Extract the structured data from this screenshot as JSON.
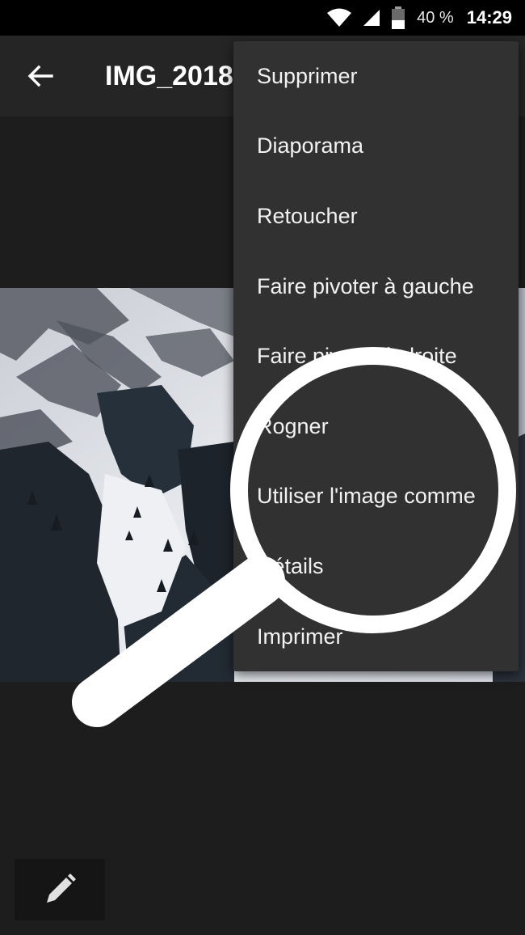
{
  "status_bar": {
    "battery_percent": "40 %",
    "time": "14:29",
    "icons": [
      "wifi-icon",
      "cell-signal-icon",
      "battery-icon"
    ]
  },
  "toolbar": {
    "title": "IMG_2018",
    "back_icon": "arrow-left-icon"
  },
  "menu": {
    "items": [
      {
        "label": "Supprimer"
      },
      {
        "label": "Diaporama"
      },
      {
        "label": "Retoucher"
      },
      {
        "label": "Faire pivoter à gauche"
      },
      {
        "label": "Faire pivoter à droite"
      },
      {
        "label": "Rogner"
      },
      {
        "label": "Utiliser l'image comme"
      },
      {
        "label": "Détails"
      },
      {
        "label": "Imprimer"
      }
    ]
  },
  "edit_button": {
    "icon": "pencil-icon"
  },
  "photo": {
    "description_icon": "snowy-mountain-photo"
  },
  "colors": {
    "background": "#1d1d1d",
    "toolbar": "#252525",
    "menu": "#313131",
    "status_bar": "#000000"
  }
}
